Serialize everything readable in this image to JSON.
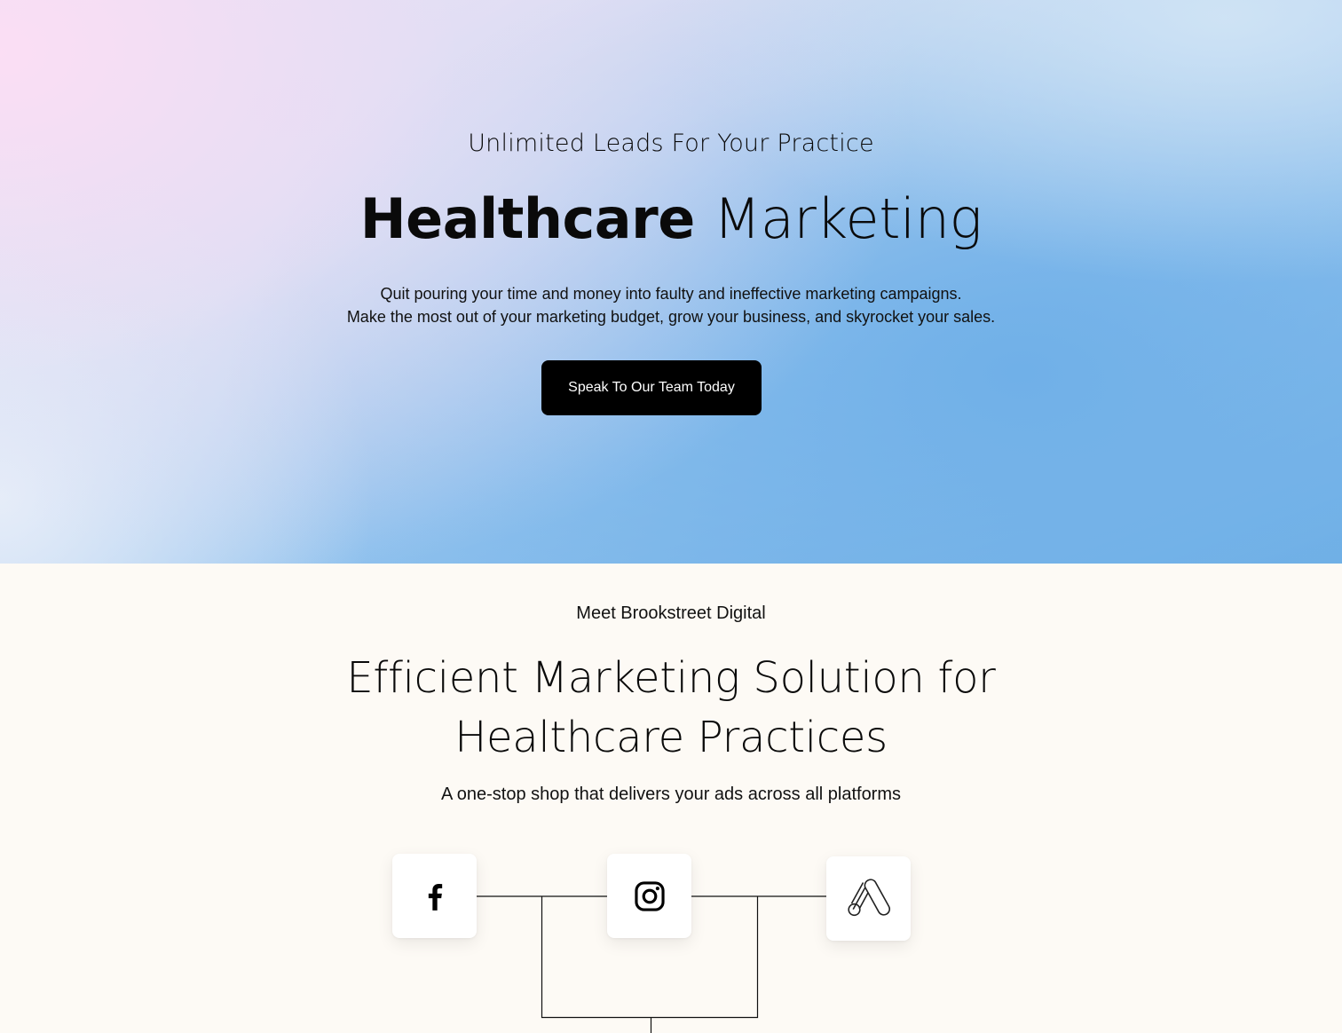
{
  "hero": {
    "eyebrow": "Unlimited Leads For Your Practice",
    "title_bold": "Healthcare",
    "title_light": "Marketing",
    "body_line1": "Quit pouring your time and money into faulty and ineffective marketing campaigns.",
    "body_line2": "Make the most out of your marketing budget, grow your business, and skyrocket your sales.",
    "cta_label": "Speak To Our Team Today"
  },
  "about": {
    "eyebrow": "Meet Brookstreet Digital",
    "heading_line1": "Efficient Marketing Solution for",
    "heading_line2": "Healthcare Practices",
    "subheading": "A one-stop shop that delivers your ads across all platforms",
    "platforms": [
      {
        "icon": "facebook-icon"
      },
      {
        "icon": "instagram-icon"
      },
      {
        "icon": "google-ads-icon"
      }
    ]
  },
  "colors": {
    "cta_background": "#000000",
    "section_background": "#fdfaf5",
    "hero_blue": "#6fb0e5",
    "hero_pink": "#fcdef4"
  }
}
